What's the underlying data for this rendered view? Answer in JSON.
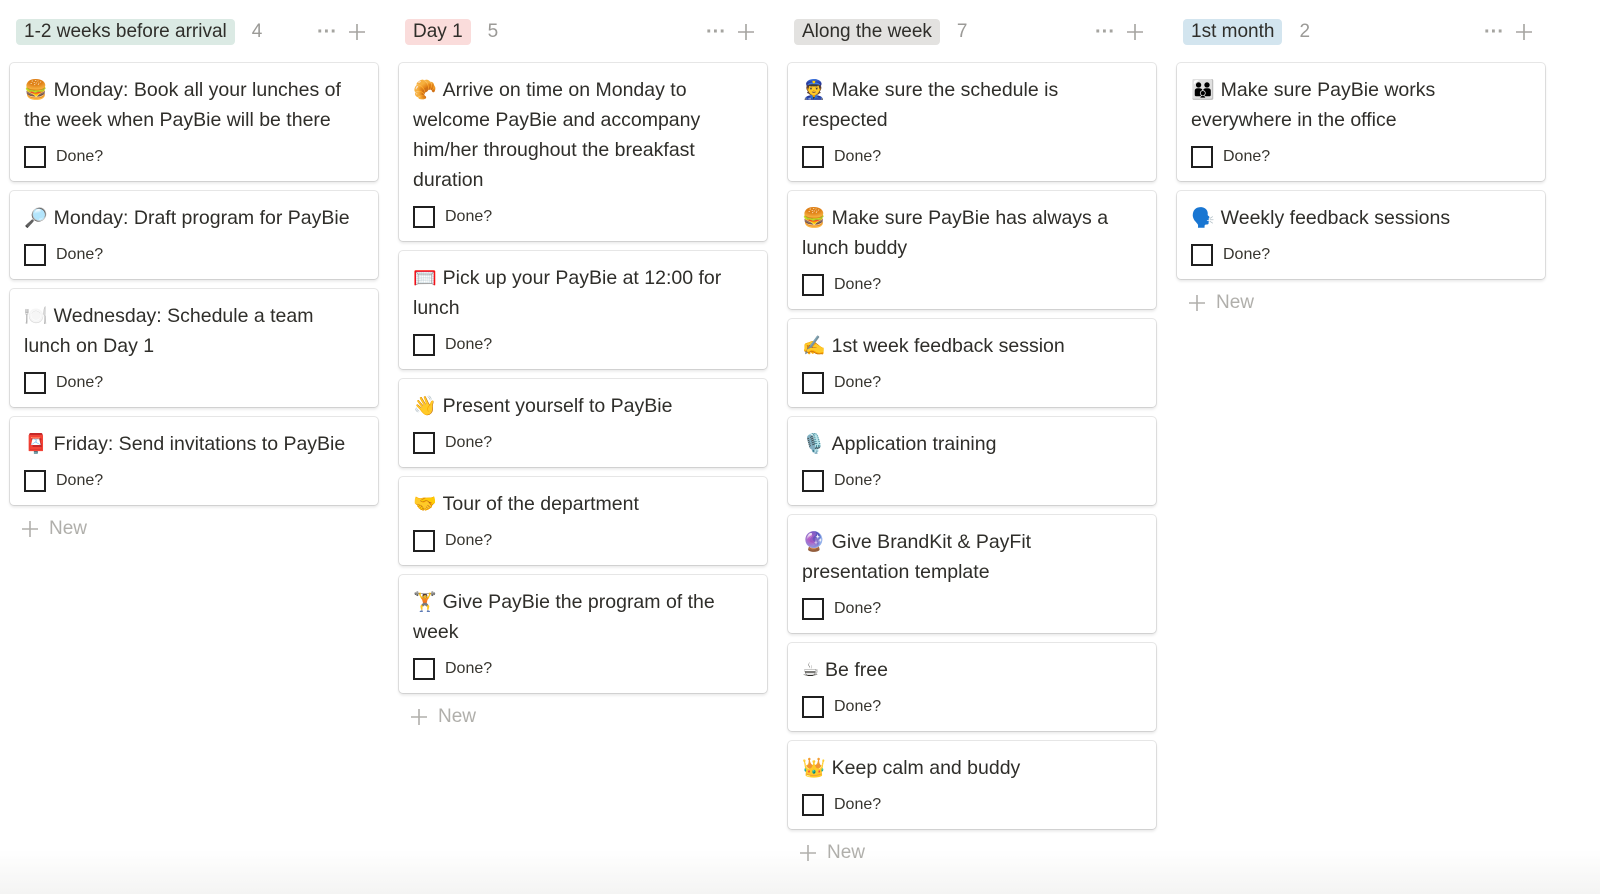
{
  "board": {
    "columns": [
      {
        "title": "1-2 weeks before arrival",
        "count": "4",
        "color": "#dbeae4",
        "more_icon": "ellipsis-icon",
        "add_icon": "plus-icon",
        "new_label": "New",
        "cards": [
          {
            "emoji": "🍔",
            "icon": "hamburger-icon",
            "title": "Monday: Book all your lunches of the week when PayBie will be there",
            "prop": "Done?",
            "checked": false
          },
          {
            "emoji": "🔎",
            "icon": "magnifying-glass-icon",
            "title": "Monday: Draft program for PayBie",
            "prop": "Done?",
            "checked": false
          },
          {
            "emoji": "🍽️",
            "icon": "plate-cutlery-icon",
            "title": "Wednesday: Schedule a team lunch on Day 1",
            "prop": "Done?",
            "checked": false
          },
          {
            "emoji": "📮",
            "icon": "postbox-icon",
            "title": "Friday: Send invitations to PayBie",
            "prop": "Done?",
            "checked": false
          }
        ]
      },
      {
        "title": "Day 1",
        "count": "5",
        "color": "#fadcdb",
        "more_icon": "ellipsis-icon",
        "add_icon": "plus-icon",
        "new_label": "New",
        "cards": [
          {
            "emoji": "🥐",
            "icon": "croissant-icon",
            "title": "Arrive on time on Monday to welcome PayBie and accompany him/her throughout the breakfast duration",
            "prop": "Done?",
            "checked": false
          },
          {
            "emoji": "🥅",
            "icon": "goal-net-icon",
            "title": "Pick up your PayBie at 12:00 for lunch",
            "prop": "Done?",
            "checked": false
          },
          {
            "emoji": "👋",
            "icon": "waving-hand-icon",
            "title": "Present yourself to PayBie",
            "prop": "Done?",
            "checked": false
          },
          {
            "emoji": "🤝",
            "icon": "handshake-icon",
            "title": "Tour of the department",
            "prop": "Done?",
            "checked": false
          },
          {
            "emoji": "🏋️",
            "icon": "weightlifter-icon",
            "title": "Give PayBie the program of the week",
            "prop": "Done?",
            "checked": false
          }
        ]
      },
      {
        "title": "Along the week",
        "count": "7",
        "color": "#e3e2e0",
        "more_icon": "ellipsis-icon",
        "add_icon": "plus-icon",
        "new_label": "New",
        "cards": [
          {
            "emoji": "👮",
            "icon": "police-officer-icon",
            "title": "Make sure the schedule is respected",
            "prop": "Done?",
            "checked": false
          },
          {
            "emoji": "🍔",
            "icon": "hamburger-icon",
            "title": "Make sure PayBie has always a lunch buddy",
            "prop": "Done?",
            "checked": false
          },
          {
            "emoji": "✍️",
            "icon": "writing-hand-icon",
            "title": "1st week feedback session",
            "prop": "Done?",
            "checked": false
          },
          {
            "emoji": "🎙️",
            "icon": "microphone-icon",
            "title": "Application training",
            "prop": "Done?",
            "checked": false
          },
          {
            "emoji": "🔮",
            "icon": "crystal-ball-icon",
            "title": "Give BrandKit & PayFit presentation template",
            "prop": "Done?",
            "checked": false
          },
          {
            "emoji": "☕",
            "icon": "coffee-icon",
            "title": "Be free",
            "prop": "Done?",
            "checked": false
          },
          {
            "emoji": "👑",
            "icon": "crown-icon",
            "title": "Keep calm and buddy",
            "prop": "Done?",
            "checked": false
          }
        ]
      },
      {
        "title": "1st month",
        "count": "2",
        "color": "#d3e5ef",
        "more_icon": "ellipsis-icon",
        "add_icon": "plus-icon",
        "new_label": "New",
        "cards": [
          {
            "emoji": "👪",
            "icon": "family-icon",
            "title": "Make sure PayBie works everywhere in the office",
            "prop": "Done?",
            "checked": false
          },
          {
            "emoji": "🗣️",
            "icon": "speaking-head-icon",
            "title": "Weekly feedback sessions",
            "prop": "Done?",
            "checked": false
          }
        ]
      }
    ]
  }
}
